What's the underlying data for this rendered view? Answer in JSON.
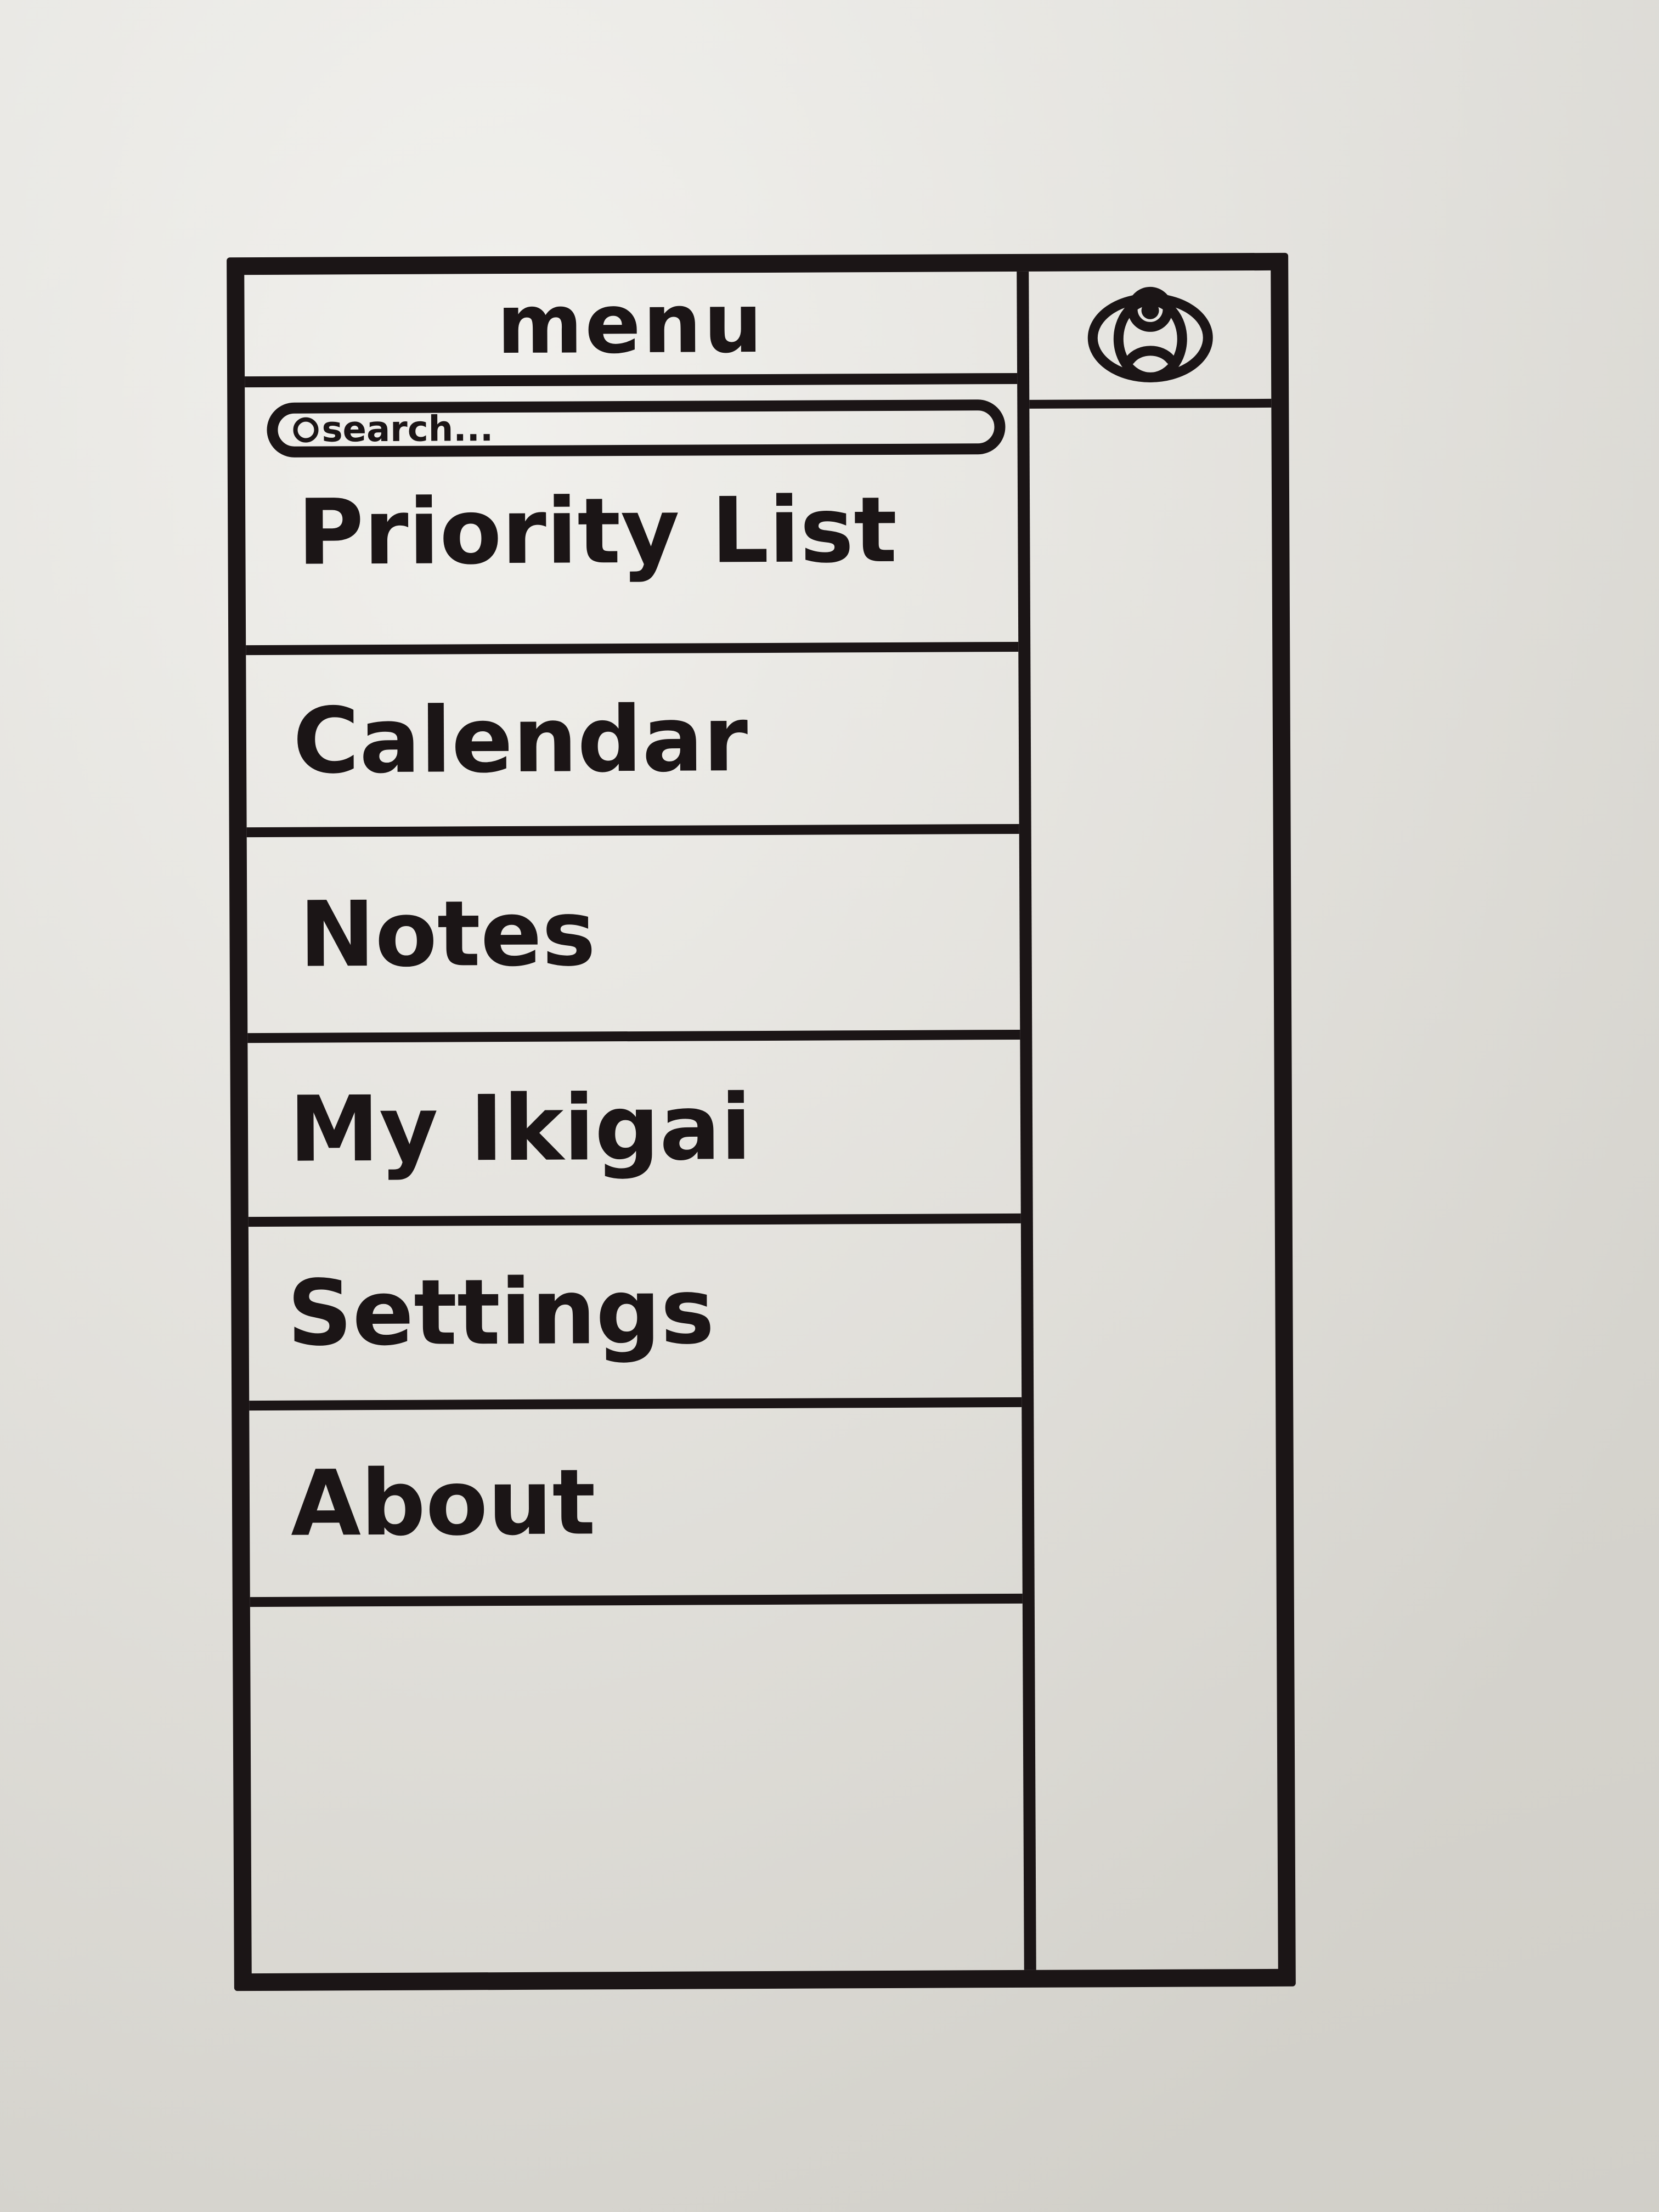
{
  "drawer": {
    "title": "menu",
    "search": {
      "placeholder": "search..."
    },
    "items": [
      {
        "label": "Priority List"
      },
      {
        "label": "Calendar"
      },
      {
        "label": "Notes"
      },
      {
        "label": "My Ikigai"
      },
      {
        "label": "Settings"
      },
      {
        "label": "About"
      }
    ]
  },
  "right_panel": {
    "header_icon": "profile-icon"
  },
  "colors": {
    "ink": "#1b1516",
    "paper": "#e8e6e0"
  }
}
